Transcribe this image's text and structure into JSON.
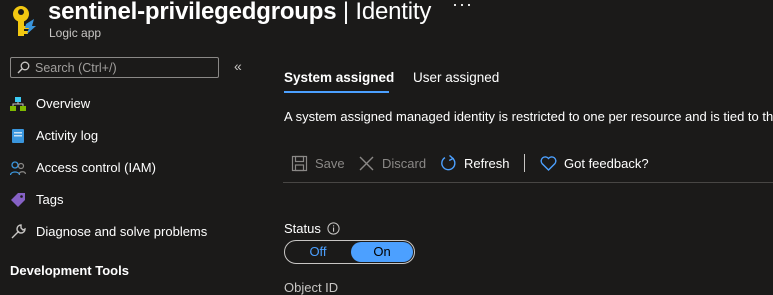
{
  "header": {
    "resource_name": "sentinel-privilegedgroups",
    "separator": "|",
    "blade_title": "Identity",
    "more": "···",
    "subtitle": "Logic app"
  },
  "sidebar": {
    "search_placeholder": "Search (Ctrl+/)",
    "collapse": "«",
    "items": [
      {
        "label": "Overview",
        "icon": "overview-icon"
      },
      {
        "label": "Activity log",
        "icon": "activity-log-icon"
      },
      {
        "label": "Access control (IAM)",
        "icon": "people-icon"
      },
      {
        "label": "Tags",
        "icon": "tag-icon"
      },
      {
        "label": "Diagnose and solve problems",
        "icon": "wrench-icon"
      }
    ],
    "section_heading": "Development Tools"
  },
  "tabs": [
    {
      "label": "System assigned",
      "selected": true
    },
    {
      "label": "User assigned",
      "selected": false
    }
  ],
  "description": "A system assigned managed identity is restricted to one per resource and is tied to th",
  "toolbar": {
    "save": "Save",
    "discard": "Discard",
    "refresh": "Refresh",
    "feedback": "Got feedback?"
  },
  "status": {
    "label": "Status",
    "off": "Off",
    "on": "On",
    "value": "On"
  },
  "object_id_label": "Object ID",
  "colors": {
    "background": "#1b1a19",
    "accent": "#4ca0ff",
    "disabled_text": "#8a8886"
  }
}
